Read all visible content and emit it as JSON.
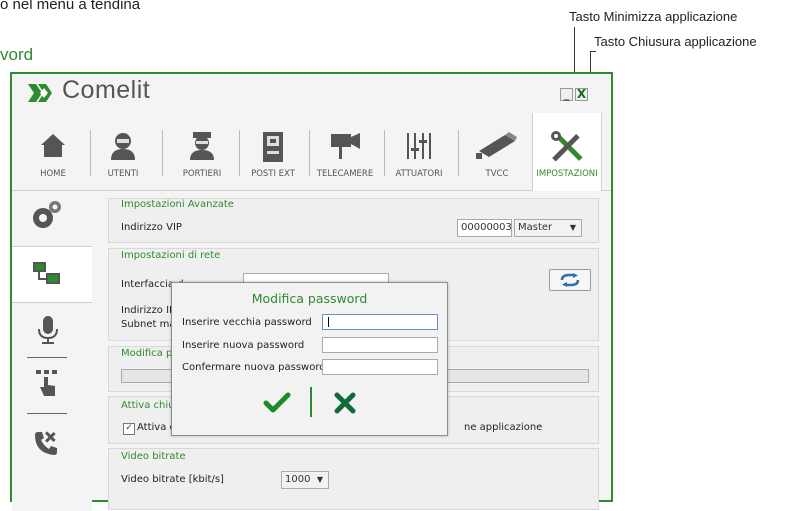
{
  "background_labels": {
    "top_left_text": "o nel menù a tendina",
    "section_heading": "vord"
  },
  "annotations": {
    "minimize": "Tasto Minimizza applicazione",
    "close": "Tasto Chiusura applicazione"
  },
  "app": {
    "logo_text": "Comelit",
    "minimize_symbol": "_",
    "close_symbol": "X"
  },
  "tabs": [
    {
      "label": "HOME",
      "icon": "home-icon"
    },
    {
      "label": "UTENTI",
      "icon": "user-icon"
    },
    {
      "label": "PORTIERI",
      "icon": "doorman-icon"
    },
    {
      "label": "POSTI EXT",
      "icon": "intercom-panel-icon"
    },
    {
      "label": "TELECAMERE",
      "icon": "camera-icon"
    },
    {
      "label": "ATTUATORI",
      "icon": "sliders-icon"
    },
    {
      "label": "TVCC",
      "icon": "cctv-icon"
    },
    {
      "label": "IMPOSTAZIONI",
      "icon": "tools-icon",
      "active": true
    }
  ],
  "sidebar": [
    {
      "icon": "gears-icon"
    },
    {
      "icon": "network-icon",
      "active": true
    },
    {
      "icon": "microphone-icon"
    },
    {
      "icon": "touch-keypad-icon"
    },
    {
      "icon": "phone-tools-icon"
    }
  ],
  "settings": {
    "advanced": {
      "title": "Impostazioni Avanzate",
      "vip_label": "Indirizzo VIP",
      "vip_value": "00000003",
      "role_value": "Master"
    },
    "network": {
      "title": "Impostazioni di rete",
      "interface_label": "Interfaccia d",
      "ip_label": "Indirizzo IP",
      "subnet_label": "Subnet mask"
    },
    "password": {
      "title": "Modifica pass"
    },
    "close_app": {
      "title": "Attiva chiusu",
      "checkbox1_label": "Attiva chi",
      "checkbox2_label": "ne applicazione"
    },
    "video": {
      "title": "Video bitrate",
      "label": "Video bitrate [kbit/s]",
      "value": "1000"
    }
  },
  "dialog": {
    "title": "Modifica password",
    "old_label": "Inserire vecchia password",
    "new_label": "Inserire nuova password",
    "confirm_label": "Confermare nuova password",
    "old_value": "",
    "new_value": "",
    "confirm_value": ""
  },
  "colors": {
    "accent_green": "#2f8a2f",
    "frame_green": "#2e8b2e",
    "confirm_green": "#1f8a2a",
    "cancel_green": "#0f6b3a"
  }
}
